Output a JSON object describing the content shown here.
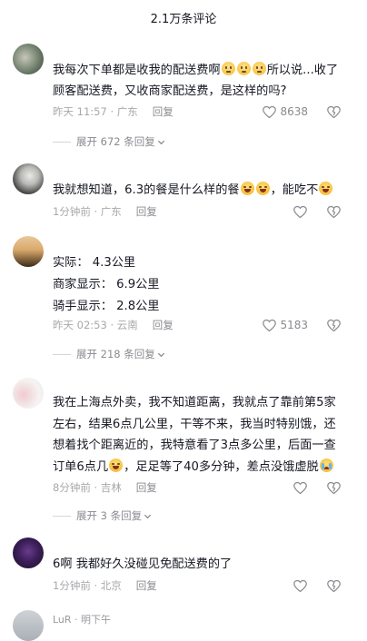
{
  "header": {
    "title": "2.1万条评论"
  },
  "comments": [
    {
      "username": "",
      "text_parts": [
        "我每次下单都是收我的配送费啊",
        "",
        "",
        "",
        "所以说...收了顾客配送费，又收商家配送费，是这样的吗?"
      ],
      "emojis": [
        "worried-emoji",
        "worried-emoji",
        "worried-emoji"
      ],
      "time": "昨天 11:57 · 广东",
      "reply": "回复",
      "likes": "8638",
      "expand": "展开 672 条回复"
    },
    {
      "username": "",
      "text_parts": [
        "我就想知道，6.3的餐是什么样的餐",
        "",
        "，能吃不",
        ""
      ],
      "emojis": [
        "laugh-cry-emoji",
        "laugh-cry-emoji",
        "laugh-cry-emoji"
      ],
      "time": "1分钟前 · 广东",
      "reply": "回复",
      "likes": ""
    },
    {
      "username": "",
      "lines": [
        "实际：  4.3公里",
        "商家显示：  6.9公里",
        "骑手显示：  2.8公里"
      ],
      "time": "昨天 02:53 · 云南",
      "reply": "回复",
      "likes": "5183",
      "expand": "展开 218 条回复"
    },
    {
      "username": "",
      "text": "我在上海点外卖，我不知道距离，我就点了靠前第5家左右，结果6点几公里，干等不来，我当时特别饿，还想着找个距离近的，我特意看了3点多公里，后面一查订单6点几",
      "text_end": "，足足等了40多分钟，差点没饿虚脱",
      "emojis": [
        "laugh-cry-emoji",
        "crying-emoji"
      ],
      "time": "8分钟前 · 吉林",
      "reply": "回复",
      "likes": "",
      "expand": "展开 3 条回复"
    },
    {
      "username": "",
      "text": "6啊 我都好久没碰见免配送费的了",
      "time": "1分钟前 · 北京",
      "reply": "回复",
      "likes": ""
    },
    {
      "username": "LuR",
      "time": "·  明下午",
      "partial": true
    }
  ],
  "colors": {
    "text": "#161823",
    "meta": "#9a9aa0",
    "divider": "#d6d6da"
  }
}
